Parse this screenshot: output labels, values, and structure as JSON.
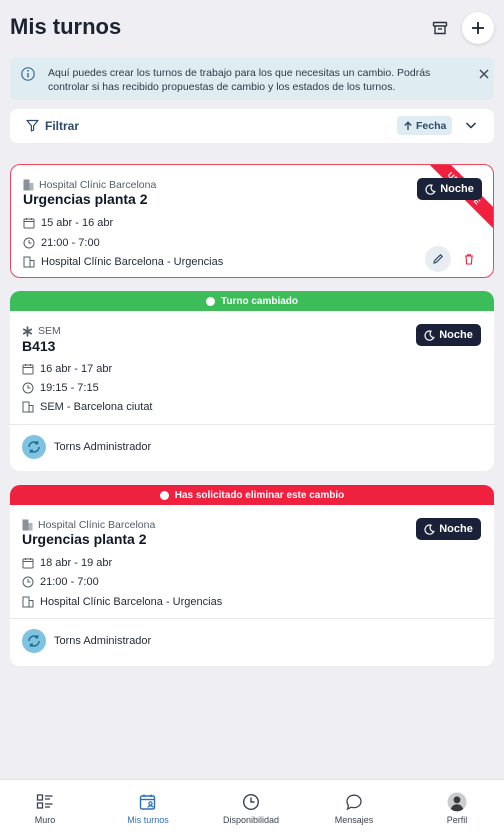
{
  "header": {
    "title": "Mis turnos"
  },
  "info": {
    "text": "Aquí puedes crear los turnos de trabajo para los que necesitas un cambio. Podrás controlar si has recibido propuestas de cambio y los estados de los turnos."
  },
  "filter": {
    "label": "Filtrar",
    "sort_label": "Fecha"
  },
  "shifts": [
    {
      "ribbon": "URGENTE",
      "hospital": "Hospital Clínic Barcelona",
      "name": "Urgencias planta 2",
      "dates": "15 abr - 16 abr",
      "time": "21:00 - 7:00",
      "location": "Hospital Clínic Barcelona - Urgencias",
      "badge": "Noche"
    },
    {
      "banner": "Turno cambiado",
      "hospital": "SEM",
      "name": "B413",
      "dates": "16 abr - 17 abr",
      "time": "19:15 - 7:15",
      "location": "SEM - Barcelona ciutat",
      "badge": "Noche",
      "admin": "Torns Administrador"
    },
    {
      "banner": "Has solicitado eliminar este cambio",
      "hospital": "Hospital Clínic Barcelona",
      "name": "Urgencias planta 2",
      "dates": "18 abr - 19 abr",
      "time": "21:00 - 7:00",
      "location": "Hospital Clínic Barcelona - Urgencias",
      "badge": "Noche",
      "admin": "Torns Administrador"
    }
  ],
  "tabs": [
    {
      "label": "Muro",
      "icon": "wall-icon"
    },
    {
      "label": "Mis turnos",
      "icon": "calendar-user-icon",
      "active": true
    },
    {
      "label": "Disponibilidad",
      "icon": "clock-icon"
    },
    {
      "label": "Mensajes",
      "icon": "chat-icon"
    },
    {
      "label": "Perfil",
      "icon": "profile-avatar"
    }
  ],
  "colors": {
    "accent": "#2d6fb7",
    "urgent": "#f0213f",
    "changed": "#3cbd5a",
    "badge": "#1a2239",
    "info_bg": "#dfecf2"
  }
}
